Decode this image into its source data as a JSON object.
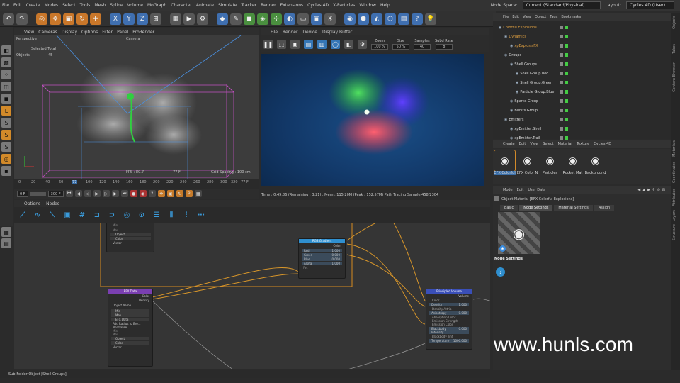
{
  "menubar": {
    "items": [
      "File",
      "Edit",
      "Create",
      "Modes",
      "Select",
      "Tools",
      "Mesh",
      "Spline",
      "Volume",
      "MoGraph",
      "Character",
      "Animate",
      "Simulate",
      "Tracker",
      "Render",
      "Extensions",
      "Cycles 4D",
      "X-Particles",
      "Window",
      "Help"
    ],
    "node_space_label": "Node Space:",
    "node_space_value": "Current (Standard/Physical)",
    "layout_label": "Layout:",
    "layout_value": "Cycles 4D (User)"
  },
  "viewport": {
    "menu": [
      "View",
      "Cameras",
      "Display",
      "Options",
      "Filter",
      "Panel",
      "ProRender"
    ],
    "mode": "Perspective",
    "camera": "Camera",
    "selected_total": "Selected Total",
    "objects_label": "Objects",
    "objects_value": "45",
    "fps": "FPS : 80.7",
    "frame": "77 F",
    "grid": "Grid Spacing : 100 cm"
  },
  "ruler": {
    "ticks": [
      "0",
      "20",
      "40",
      "60",
      "77",
      "100",
      "120",
      "140",
      "160",
      "180",
      "200",
      "220",
      "240",
      "260",
      "280",
      "300",
      "320"
    ],
    "current": "77 F"
  },
  "timeline": {
    "start": "0 F",
    "end": "300 F"
  },
  "render_view": {
    "menu": [
      "File",
      "Render",
      "Device",
      "Display Buffer"
    ],
    "zoom_label": "Zoom",
    "zoom": "100 %",
    "size_label": "Size",
    "size": "50 %",
    "samples_label": "Samples",
    "samples": "40",
    "subd_label": "Subd Rate",
    "subd": "8",
    "status": "Time : 0:49.86 (Remaining : 3:21) , Mem : 115.20M (Peak : 152.57M)  Path Tracing Sample 458/2304"
  },
  "node_editor": {
    "menu": [
      "Options",
      "Nodes"
    ],
    "nodes": {
      "efx_data": {
        "title": "EFX Data",
        "outputs": [
          "Color",
          "Density"
        ],
        "rows": [
          "Object Name",
          "Min",
          "Max",
          "EFX Data",
          "Add Radius to Bro...",
          "Normalise",
          "Min",
          "Max",
          "Object",
          "Color",
          "Vector"
        ]
      },
      "rgb_gradient": {
        "title": "RGB Gradient",
        "rows": [
          "Color",
          "Red",
          "Green",
          "Blue",
          "Alpha",
          "Fac"
        ],
        "values": [
          "",
          "1.000",
          "0.000",
          "0.000",
          "1.000",
          ""
        ]
      },
      "principled_volume": {
        "title": "Principled Volume",
        "rows": [
          "Volume",
          "Color",
          "Density",
          "Density Attrib",
          "Anisotropy",
          "Absorption Color",
          "Emission Strength",
          "Emission Color",
          "Blackbody Intensity",
          "Blackbody Tint",
          "Temperature"
        ],
        "values": [
          "",
          "",
          "1.000",
          "",
          "0.000",
          "",
          "",
          "",
          "0.000",
          "",
          "1000.000"
        ]
      },
      "partial": {
        "rows": [
          "Min",
          "Max",
          "Object",
          "Color",
          "Vector"
        ]
      }
    }
  },
  "statusbar": {
    "text": "Sub-Folder Object [Shell Groups]"
  },
  "object_manager": {
    "menu": [
      "File",
      "Edit",
      "View",
      "Object",
      "Tags",
      "Bookmarks"
    ],
    "items": [
      {
        "name": "Colorful Explosions",
        "indent": 0,
        "color": "#e0a040"
      },
      {
        "name": "Dynamics",
        "indent": 1,
        "color": "#e0a040"
      },
      {
        "name": "xpExplosiaFX",
        "indent": 2,
        "color": "#e0a040"
      },
      {
        "name": "Groups",
        "indent": 1,
        "color": "#dddddd"
      },
      {
        "name": "Shell Groups",
        "indent": 2,
        "color": "#dddddd"
      },
      {
        "name": "Shell Group.Red",
        "indent": 3,
        "color": "#dddddd"
      },
      {
        "name": "Shell Group.Green",
        "indent": 3,
        "color": "#dddddd"
      },
      {
        "name": "Particle Group.Blue",
        "indent": 3,
        "color": "#dddddd"
      },
      {
        "name": "Sparks Group",
        "indent": 2,
        "color": "#dddddd"
      },
      {
        "name": "Bursts Group",
        "indent": 2,
        "color": "#dddddd"
      },
      {
        "name": "Emitters",
        "indent": 1,
        "color": "#dddddd"
      },
      {
        "name": "xpEmitter.Shell",
        "indent": 2,
        "color": "#dddddd"
      },
      {
        "name": "xpEmitter.Trail",
        "indent": 2,
        "color": "#dddddd"
      }
    ]
  },
  "material_manager": {
    "menu": [
      "Create",
      "Edit",
      "View",
      "Select",
      "Material",
      "Texture",
      "Cycles 4D"
    ],
    "materials": [
      {
        "label": "EFX Colorful",
        "color": "#4a4a4a",
        "selected": true
      },
      {
        "label": "EFX Color N",
        "color": "#c9772a",
        "selected": false
      },
      {
        "label": "Particles",
        "color": "#5a5a5a",
        "selected": false
      },
      {
        "label": "Rocket Mat",
        "color": "#5a5a5a",
        "selected": false
      },
      {
        "label": "Background",
        "color": "#6a6a6a",
        "selected": false
      }
    ]
  },
  "attribute_manager": {
    "menu": [
      "Mode",
      "Edit",
      "User Data"
    ],
    "title": "Object Material [EFX Colorful Explosions]",
    "tabs": [
      "Basic",
      "Node Settings",
      "Material Settings",
      "Assign"
    ],
    "active_tab": "Node Settings",
    "section": "Node Settings",
    "help": "?"
  },
  "right_tabs": [
    "Objects",
    "Takes",
    "Content Browser",
    "Materials",
    "Coordinates",
    "Attributes",
    "Layers",
    "Structure"
  ],
  "watermark": "www.hunls.com"
}
